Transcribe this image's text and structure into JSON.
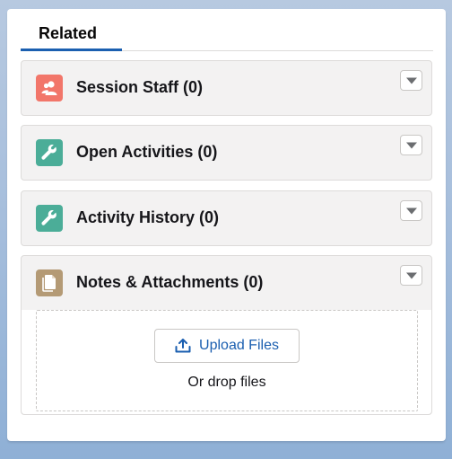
{
  "tabs": [
    {
      "label": "Related",
      "active": true
    }
  ],
  "panels": [
    {
      "title": "Session Staff (0)",
      "icon": "users-icon",
      "icon_color": "#f2766a"
    },
    {
      "title": "Open Activities (0)",
      "icon": "wrench-icon",
      "icon_color": "#4bad98"
    },
    {
      "title": "Activity History (0)",
      "icon": "wrench-icon",
      "icon_color": "#4bad98"
    },
    {
      "title": "Notes & Attachments (0)",
      "icon": "document-icon",
      "icon_color": "#b49a75"
    }
  ],
  "upload": {
    "button_label": "Upload Files",
    "drop_text": "Or drop files"
  },
  "colors": {
    "accent": "#1b5fb0",
    "panel_bg": "#f3f2f2",
    "border": "#dddbda"
  }
}
